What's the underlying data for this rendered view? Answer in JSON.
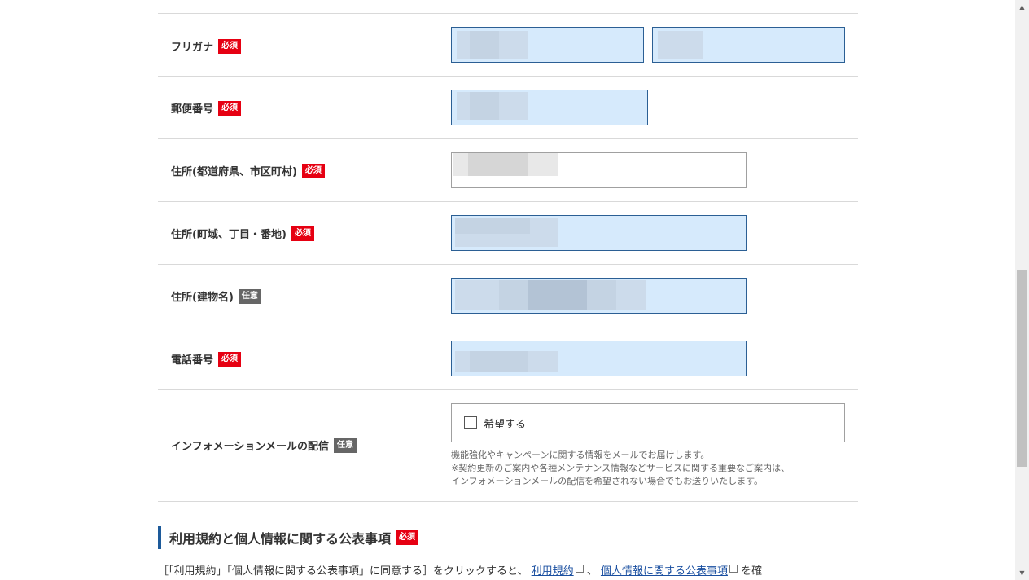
{
  "badges": {
    "required": "必須",
    "optional": "任意"
  },
  "form": {
    "furigana": {
      "label": "フリガナ"
    },
    "postal": {
      "label": "郵便番号"
    },
    "address_pref_city": {
      "label": "住所(都道府県、市区町村)"
    },
    "address_town": {
      "label": "住所(町域、丁目・番地)"
    },
    "address_building": {
      "label": "住所(建物名)"
    },
    "phone": {
      "label": "電話番号"
    },
    "info_mail": {
      "label": "インフォメーションメールの配信",
      "checkbox_label": "希望する",
      "checked": false,
      "note_lines": [
        "機能強化やキャンペーンに関する情報をメールでお届けします。",
        "※契約更新のご案内や各種メンテナンス情報などサービスに関する重要なご案内は、",
        "インフォメーションメールの配信を希望されない場合でもお送りいたします。"
      ]
    }
  },
  "terms_section": {
    "heading": "利用規約と個人情報に関する公表事項",
    "text_prefix": "［「利用規約」「個人情報に関する公表事項」に同意する］をクリックすると、",
    "link_terms": "利用規約",
    "separator": "、",
    "link_privacy": "個人情報に関する公表事項",
    "text_suffix": "を確"
  },
  "colors": {
    "required_badge": "#e60012",
    "optional_badge": "#666666",
    "filled_field_bg": "#d6eafc",
    "filled_field_border": "#2b5f94",
    "section_accent": "#1d5a9a",
    "link": "#1a4fa0"
  }
}
